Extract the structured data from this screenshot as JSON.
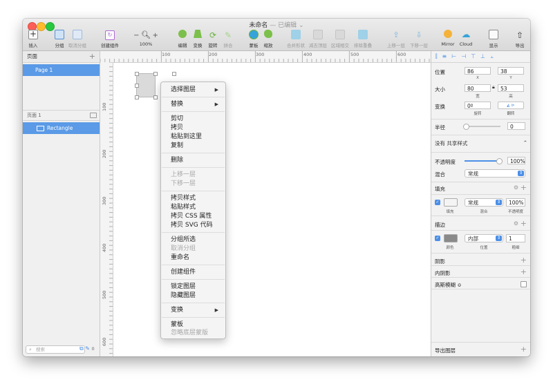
{
  "window": {
    "title": "未命名",
    "title_sep": " — ",
    "subtitle": "已编辑 ⌄"
  },
  "toolbar": {
    "insert": "插入",
    "group": "分组",
    "ungroup": "取消分组",
    "create_symbol": "创建组件",
    "zoom_minus": "−",
    "zoom_plus": "+",
    "zoom_level": "100%",
    "edit": "编辑",
    "transform": "变换",
    "rotate": "旋转",
    "flatten": "拼合",
    "mask": "蒙板",
    "scale": "缩放",
    "union": "合并形状",
    "subtract": "减去顶层",
    "intersect": "区域相交",
    "difference": "排除重叠",
    "forward": "上移一层",
    "backward": "下移一层",
    "mirror": "Mirror",
    "cloud": "Cloud",
    "view": "显示",
    "export": "导出"
  },
  "left_panel": {
    "pages_title": "页面",
    "add": "+",
    "page_item": "Page 1",
    "layers_title": "页面 1",
    "layer_item": "Rectangle",
    "search_placeholder": "搜索",
    "badge": "0"
  },
  "rulers": {
    "top": [
      "100",
      "200",
      "300",
      "400",
      "500",
      "600"
    ],
    "left": [
      "100",
      "200",
      "300",
      "400",
      "500",
      "600"
    ]
  },
  "context_menu": {
    "items": [
      "选择图层",
      "替换",
      "剪切",
      "拷贝",
      "粘贴到这里",
      "复制",
      "删除",
      "上移一层",
      "下移一层",
      "拷贝样式",
      "粘贴样式",
      "拷贝 CSS 属性",
      "拷贝 SVG 代码",
      "分组所选",
      "取消分组",
      "重命名",
      "创建组件",
      "锁定图层",
      "隐藏图层",
      "变换",
      "蒙板",
      "忽略底层蒙版"
    ],
    "arrow": "▶"
  },
  "inspector": {
    "position_label": "位置",
    "x_value": "86",
    "y_value": "38",
    "x": "X",
    "y": "Y",
    "size_label": "大小",
    "w_value": "80",
    "h_value": "53",
    "w": "宽",
    "h": "高",
    "transform_label": "变换",
    "rotate_value": "0º",
    "rotate": "旋转",
    "flip": "翻转",
    "radius_label": "半径",
    "radius_value": "0",
    "shared_style": "没有 共享样式",
    "opacity_label": "不透明度",
    "opacity_value": "100%",
    "blend_label": "混合",
    "blend_value": "常规",
    "fill_title": "填充",
    "fill_mode": "常规",
    "fill_opacity": "100%",
    "fill_sub": "填充",
    "blend_sub": "混合",
    "opacity_sub": "不透明度",
    "border_title": "描边",
    "border_pos": "内部",
    "border_width": "1",
    "color_sub": "颜色",
    "pos_sub": "位置",
    "thick_sub": "粗细",
    "shadow_title": "阴影",
    "inner_shadow_title": "内阴影",
    "blur_title": "高斯模糊 ≎",
    "export_title": "导出图层"
  },
  "colors": {
    "accent": "#5a9ae6",
    "fill": "#dadada",
    "border": "#8a8a8a"
  }
}
